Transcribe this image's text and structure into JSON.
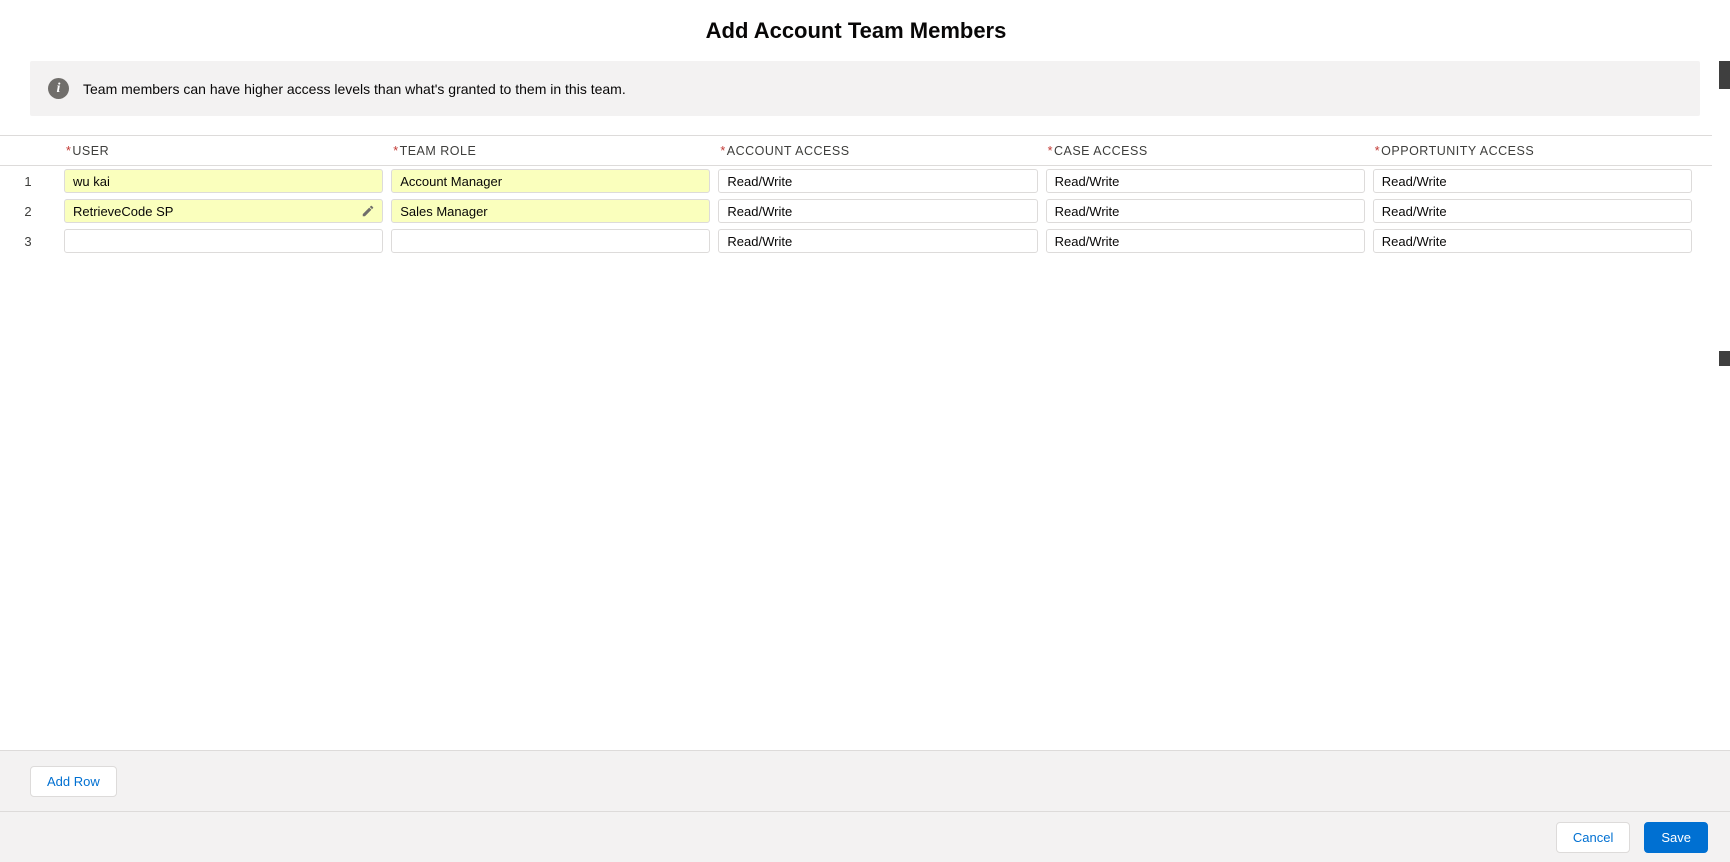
{
  "page": {
    "title": "Add Account Team Members"
  },
  "banner": {
    "text": "Team members can have higher access levels than what's granted to them in this team."
  },
  "table": {
    "required_marker": "*",
    "columns": [
      {
        "label": "USER"
      },
      {
        "label": "TEAM ROLE"
      },
      {
        "label": "ACCOUNT ACCESS"
      },
      {
        "label": "CASE ACCESS"
      },
      {
        "label": "OPPORTUNITY ACCESS"
      }
    ],
    "rows": [
      {
        "num": "1",
        "user": "wu kai",
        "team_role": "Account Manager",
        "account_access": "Read/Write",
        "case_access": "Read/Write",
        "opportunity_access": "Read/Write"
      },
      {
        "num": "2",
        "user": "RetrieveCode SP",
        "team_role": "Sales Manager",
        "account_access": "Read/Write",
        "case_access": "Read/Write",
        "opportunity_access": "Read/Write"
      },
      {
        "num": "3",
        "user": "",
        "team_role": "",
        "account_access": "Read/Write",
        "case_access": "Read/Write",
        "opportunity_access": "Read/Write"
      }
    ]
  },
  "buttons": {
    "add_row": "Add Row",
    "cancel": "Cancel",
    "save": "Save"
  },
  "colors": {
    "accent": "#0070d2",
    "required": "#c23934",
    "edited_cell": "#faffbd",
    "bar_background": "#f3f2f2"
  }
}
